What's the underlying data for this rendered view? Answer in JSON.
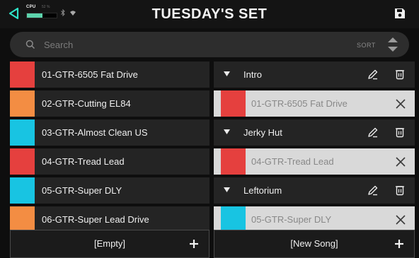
{
  "header": {
    "title": "TUESDAY'S SET",
    "cpu_label": "CPU",
    "cpu_percent_text": "52 %",
    "cpu_load": 0.52,
    "back_icon": "back-arrow-icon",
    "save_icon": "save-icon",
    "bluetooth_icon": "bluetooth-icon",
    "wifi_icon": "wifi-icon"
  },
  "search": {
    "placeholder": "Search",
    "value": "",
    "sort_label": "SORT"
  },
  "colors": {
    "red": "#e5403e",
    "orange": "#f38d43",
    "cyan": "#18c4e2",
    "accent_green": "#5dd3ac"
  },
  "presets": [
    {
      "name": "01-GTR-6505 Fat Drive",
      "color": "#e5403e"
    },
    {
      "name": "02-GTR-Cutting EL84",
      "color": "#f38d43"
    },
    {
      "name": "03-GTR-Almost Clean US",
      "color": "#18c4e2"
    },
    {
      "name": "04-GTR-Tread Lead",
      "color": "#e5403e"
    },
    {
      "name": "05-GTR-Super DLY",
      "color": "#18c4e2"
    },
    {
      "name": "06-GTR-Super Lead Drive",
      "color": "#f38d43"
    }
  ],
  "songs": [
    {
      "name": "Intro",
      "preset": {
        "name": "01-GTR-6505 Fat Drive",
        "color": "#e5403e"
      }
    },
    {
      "name": "Jerky Hut",
      "preset": {
        "name": "04-GTR-Tread Lead",
        "color": "#e5403e"
      }
    },
    {
      "name": "Leftorium",
      "preset": {
        "name": "05-GTR-Super DLY",
        "color": "#18c4e2"
      }
    }
  ],
  "buttons": {
    "empty_label": "[Empty]",
    "new_song_label": "[New Song]"
  }
}
